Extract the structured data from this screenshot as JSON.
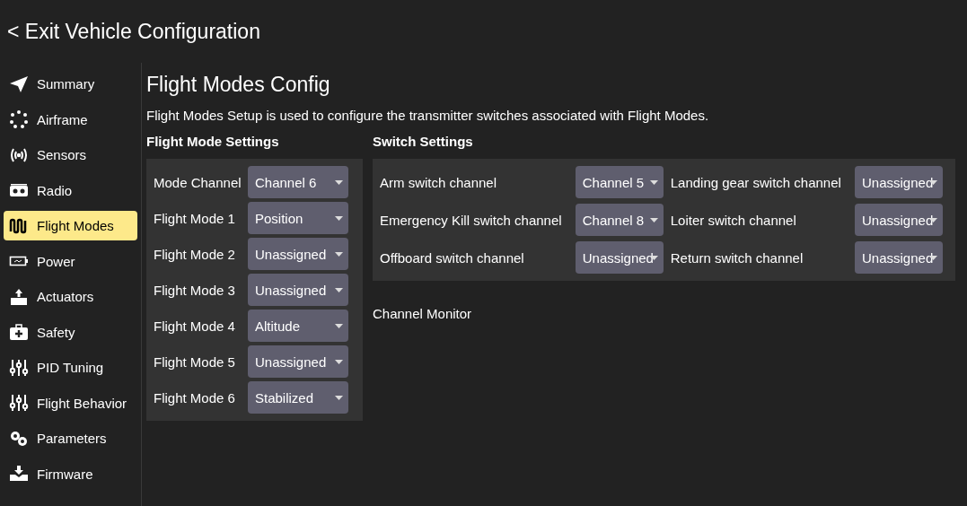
{
  "header": {
    "back_link": "< Exit Vehicle Configuration"
  },
  "sidebar": {
    "items": [
      {
        "label": "Summary",
        "selected": false
      },
      {
        "label": "Airframe",
        "selected": false
      },
      {
        "label": "Sensors",
        "selected": false
      },
      {
        "label": "Radio",
        "selected": false
      },
      {
        "label": "Flight Modes",
        "selected": true
      },
      {
        "label": "Power",
        "selected": false
      },
      {
        "label": "Actuators",
        "selected": false
      },
      {
        "label": "Safety",
        "selected": false
      },
      {
        "label": "PID Tuning",
        "selected": false
      },
      {
        "label": "Flight Behavior",
        "selected": false
      },
      {
        "label": "Parameters",
        "selected": false
      },
      {
        "label": "Firmware",
        "selected": false
      }
    ]
  },
  "page": {
    "title": "Flight Modes Config",
    "description": "Flight Modes Setup is used to configure the transmitter switches associated with Flight Modes."
  },
  "flight_mode_settings": {
    "heading": "Flight Mode Settings",
    "rows": [
      {
        "label": "Mode Channel",
        "value": "Channel 6"
      },
      {
        "label": "Flight Mode 1",
        "value": "Position"
      },
      {
        "label": "Flight Mode 2",
        "value": "Unassigned"
      },
      {
        "label": "Flight Mode 3",
        "value": "Unassigned"
      },
      {
        "label": "Flight Mode 4",
        "value": "Altitude"
      },
      {
        "label": "Flight Mode 5",
        "value": "Unassigned"
      },
      {
        "label": "Flight Mode 6",
        "value": "Stabilized"
      }
    ]
  },
  "switch_settings": {
    "heading": "Switch Settings",
    "rows": [
      {
        "label": "Arm switch channel",
        "value": "Channel 5"
      },
      {
        "label": "Landing gear switch channel",
        "value": "Unassigned"
      },
      {
        "label": "Emergency Kill switch channel",
        "value": "Channel 8"
      },
      {
        "label": "Loiter switch channel",
        "value": "Unassigned"
      },
      {
        "label": "Offboard switch channel",
        "value": "Unassigned"
      },
      {
        "label": "Return switch channel",
        "value": "Unassigned"
      }
    ]
  },
  "channel_monitor": {
    "heading": "Channel Monitor"
  }
}
